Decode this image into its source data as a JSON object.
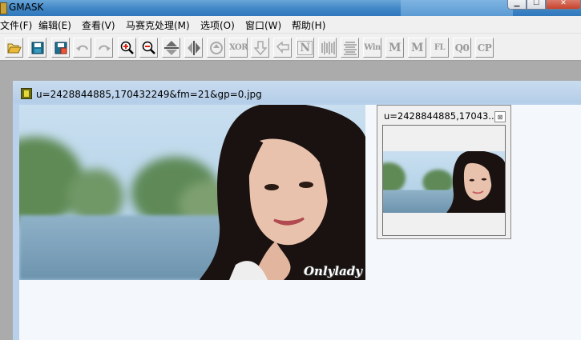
{
  "app": {
    "title": "GMASK"
  },
  "menu": {
    "items": [
      {
        "label": "文件(F)"
      },
      {
        "label": "编辑(E)"
      },
      {
        "label": "查看(V)"
      },
      {
        "label": "马赛克处理(M)"
      },
      {
        "label": "选项(O)"
      },
      {
        "label": "窗口(W)"
      },
      {
        "label": "帮助(H)"
      }
    ]
  },
  "toolbar": {
    "buttons": [
      {
        "icon": "open-folder-icon",
        "enabled": true
      },
      {
        "icon": "save-icon",
        "enabled": true
      },
      {
        "icon": "save-as-icon",
        "enabled": true
      },
      {
        "icon": "undo-icon",
        "enabled": false
      },
      {
        "icon": "redo-icon",
        "enabled": false
      },
      {
        "icon": "zoom-in-icon",
        "enabled": true
      },
      {
        "icon": "zoom-out-icon",
        "enabled": true
      },
      {
        "icon": "flip-vertical-icon",
        "enabled": true
      },
      {
        "icon": "flip-horizontal-icon",
        "enabled": true
      },
      {
        "icon": "rotate-icon",
        "enabled": false
      },
      {
        "icon": "xor-icon",
        "enabled": false
      },
      {
        "icon": "arrow-down-icon",
        "enabled": false
      },
      {
        "icon": "arrow-back-icon",
        "enabled": false
      },
      {
        "icon": "n-icon",
        "enabled": false
      },
      {
        "icon": "vertical-lines-icon",
        "enabled": false
      },
      {
        "icon": "horizontal-lines-icon",
        "enabled": false
      },
      {
        "icon": "win-icon",
        "enabled": false
      },
      {
        "icon": "m-icon",
        "enabled": false
      },
      {
        "icon": "m-dot-icon",
        "enabled": false
      },
      {
        "icon": "fl-icon",
        "enabled": false
      },
      {
        "icon": "q0-icon",
        "enabled": false
      },
      {
        "icon": "cp-icon",
        "enabled": false
      }
    ],
    "text_labels": {
      "xor": "XOR",
      "n": "N",
      "win": "Win",
      "m": "M",
      "m2": "M",
      "fl": "FL",
      "q0": "Q0",
      "cp": "CP"
    }
  },
  "document": {
    "title": "u=2428844885,170432249&fm=21&gp=0.jpg",
    "watermark": "Onlylady"
  },
  "thumbnail_panel": {
    "title": "u=2428844885,17043...",
    "close_glyph": "⊠"
  },
  "colors": {
    "titlebar": "#3f86c6",
    "workspace": "#ababab",
    "mdi_frame": "#b9d1ea",
    "client": "#f4f7fb"
  }
}
